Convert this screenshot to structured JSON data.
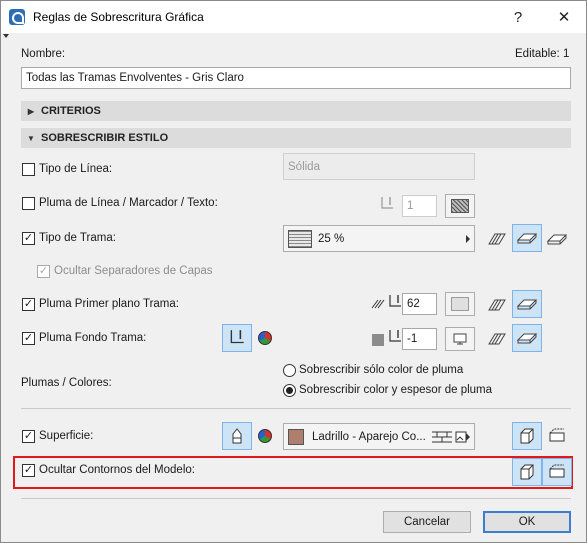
{
  "window": {
    "title": "Reglas de Sobrescritura Gráfica",
    "help_label": "?",
    "close_label": "✕"
  },
  "name": {
    "label": "Nombre:",
    "editable": "Editable: 1",
    "value": "Todas las Tramas Envolventes - Gris Claro"
  },
  "sections": {
    "criteria": "CRITERIOS",
    "override_style": "SOBRESCRIBIR ESTILO"
  },
  "line_type": {
    "label": "Tipo de Línea:",
    "checked": false,
    "value": "Sólida"
  },
  "line_pen": {
    "label": "Pluma de Línea / Marcador / Texto:",
    "checked": false,
    "pen_value": "1"
  },
  "fill_type": {
    "label": "Tipo de Trama:",
    "checked": true,
    "value": "25 %"
  },
  "hide_separators": {
    "label": "Ocultar Separadores de Capas",
    "checked": true,
    "disabled": true
  },
  "fill_fg_pen": {
    "label": "Pluma Primer plano Trama:",
    "checked": true,
    "pen_value": "62"
  },
  "fill_bg_pen": {
    "label": "Pluma Fondo Trama:",
    "checked": true,
    "pen_value": "-1"
  },
  "pens_colors": {
    "label": "Plumas / Colores:",
    "options": [
      {
        "label": "Sobrescribir sólo color de pluma",
        "selected": false
      },
      {
        "label": "Sobrescribir color y espesor de pluma",
        "selected": true
      }
    ]
  },
  "surface": {
    "label": "Superficie:",
    "checked": true,
    "value": "Ladrillo - Aparejo Co...",
    "swatch_color": "#b07e6e"
  },
  "hide_contours": {
    "label": "Ocultar Contornos del Modelo:",
    "checked": true
  },
  "buttons": {
    "cancel": "Cancelar",
    "ok": "OK"
  },
  "colors": {
    "highlight": "#e0191a",
    "active_button": "#cde4f7"
  }
}
